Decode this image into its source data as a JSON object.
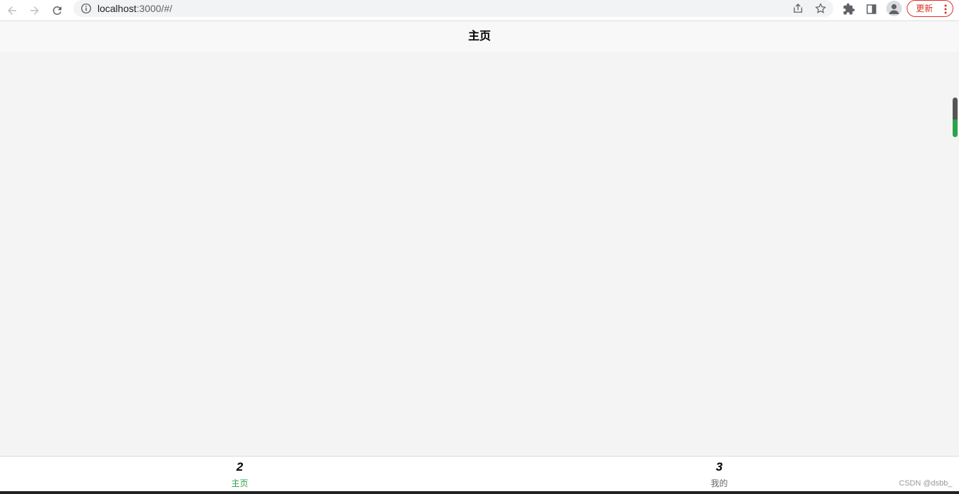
{
  "browser": {
    "url_host": "localhost",
    "url_rest": ":3000/#/",
    "update_label": "更新",
    "icons": [
      "back-arrow-icon",
      "forward-arrow-icon",
      "reload-icon",
      "info-icon",
      "share-icon",
      "star-icon",
      "extensions-icon",
      "side-panel-icon",
      "profile-avatar-icon",
      "more-vert-icon"
    ]
  },
  "header": {
    "title": "主页"
  },
  "tabbar": {
    "items": [
      {
        "glyph": "2",
        "label": "主页",
        "active": true
      },
      {
        "glyph": "3",
        "label": "我的",
        "active": false
      }
    ],
    "active_color": "#2ba245",
    "inactive_color": "#666666"
  },
  "watermark": "CSDN @dsbb_"
}
